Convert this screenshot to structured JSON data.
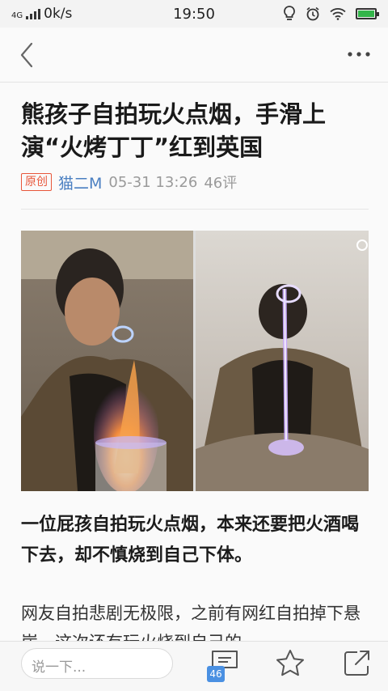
{
  "status_bar": {
    "network": "4G",
    "speed": "0k/s",
    "time": "19:50",
    "battery_color": "#33b54a"
  },
  "nav": {
    "back_icon": "chevron-left-icon",
    "more_icon": "more-dots-icon"
  },
  "article": {
    "title": "熊孩子自拍玩火点烟，手滑上演“火烤丁丁”红到英国",
    "tag": "原创",
    "author": "猫二M",
    "date": "05-31 13:26",
    "comments": "46评",
    "paragraph_1": "一位屁孩自拍玩火点烟，本来还要把火酒喝下去，却不慎烧到自己下体。",
    "paragraph_2": "网友自拍悲剧无极限，之前有网红自拍掉下悬崖，这次还有玩火烧到自己的……"
  },
  "bottom_bar": {
    "comment_placeholder": "说一下...",
    "comment_count": "46",
    "icons": [
      "comment-icon",
      "star-icon",
      "share-icon"
    ]
  },
  "colors": {
    "tag": "#e8563a",
    "author": "#4a7fc1",
    "badge": "#4a90e2"
  }
}
